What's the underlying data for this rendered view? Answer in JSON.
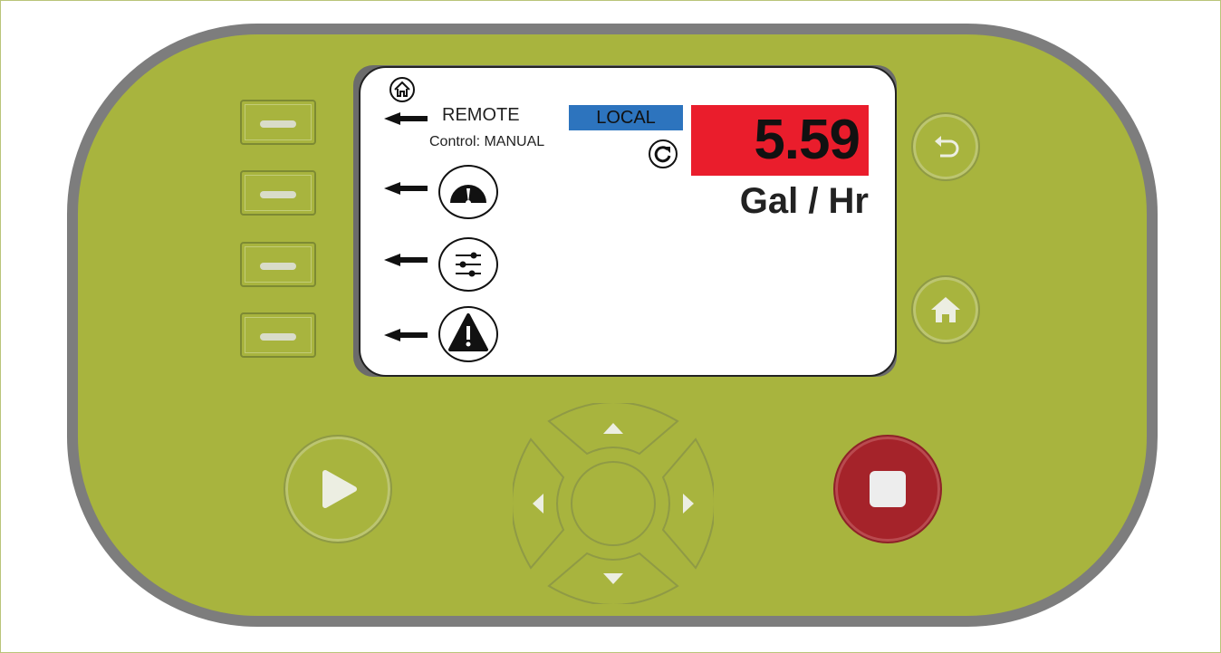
{
  "screen": {
    "remote_label": "REMOTE",
    "control_label": "Control: MANUAL",
    "local_button": "LOCAL",
    "flow_value": "5.59",
    "flow_unit": "Gal / Hr"
  },
  "icons": {
    "screen_home": "home-icon",
    "refresh": "refresh-icon",
    "gauge": "gauge-icon",
    "settings": "sliders-icon",
    "alarm": "warning-icon",
    "back": "back-icon",
    "home": "home-icon",
    "start": "play-icon",
    "stop": "stop-icon"
  },
  "colors": {
    "device_body": "#a8b43e",
    "device_border": "#7d7d7d",
    "local_button": "#2d74be",
    "value_box": "#ea1d2c",
    "stop_button": "#a5232a"
  }
}
